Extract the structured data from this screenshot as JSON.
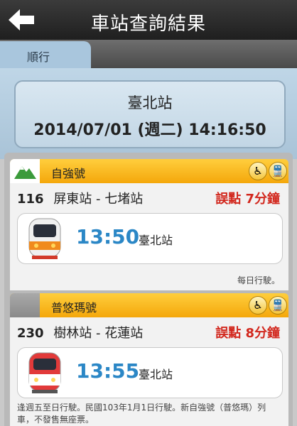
{
  "header": {
    "title": "車站查詢結果",
    "back_icon": "back-arrow-icon"
  },
  "tabs": [
    {
      "label": "順行",
      "active": true
    }
  ],
  "station_info": {
    "station": "臺北站",
    "datetime": "2014/07/01 (週二) 14:16:50"
  },
  "trains": [
    {
      "type": "自強號",
      "type_icon": "mountain-icon",
      "number": "116",
      "route": "屏東站 - 七堵站",
      "delay": "誤點 7分鐘",
      "depart_time": "13:50",
      "station": "臺北站",
      "note": "每日行駛。",
      "amenities": [
        "wheelchair-icon",
        "train-icon"
      ]
    },
    {
      "type": "普悠瑪號",
      "type_icon": "",
      "number": "230",
      "route": "樹林站 - 花蓮站",
      "delay": "誤點 8分鐘",
      "depart_time": "13:55",
      "station": "臺北站",
      "note": "逢週五至日行駛。民國103年1月1日行駛。新自強號（普悠瑪）列車，不發售無座票。",
      "amenities": [
        "wheelchair-icon",
        "train-icon"
      ]
    }
  ],
  "colors": {
    "accent": "#2b87c6",
    "delay": "#d2281e",
    "type_bar": "#f4a70b"
  }
}
